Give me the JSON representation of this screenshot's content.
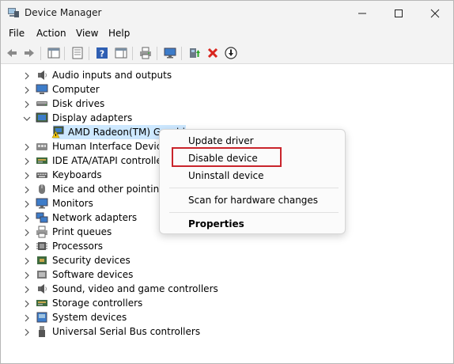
{
  "window": {
    "title": "Device Manager",
    "minimize_icon": "minimize-icon",
    "maximize_icon": "maximize-icon",
    "close_icon": "close-icon"
  },
  "menu": {
    "items": [
      "File",
      "Action",
      "View",
      "Help"
    ]
  },
  "toolbar": {
    "icons": [
      "back-arrow-icon",
      "forward-arrow-icon",
      "show-hide-tree-icon",
      "properties-sheet-icon",
      "help-icon",
      "action-pane-icon",
      "printer-icon",
      "monitor-icon",
      "update-driver-icon",
      "uninstall-x-icon",
      "download-arrow-icon"
    ]
  },
  "tree": {
    "items": [
      {
        "label": "Audio inputs and outputs",
        "icon": "speaker-icon",
        "expanded": false
      },
      {
        "label": "Computer",
        "icon": "computer-icon",
        "expanded": false
      },
      {
        "label": "Disk drives",
        "icon": "disk-drive-icon",
        "expanded": false
      },
      {
        "label": "Display adapters",
        "icon": "display-adapter-icon",
        "expanded": true
      },
      {
        "label": "AMD Radeon(TM) Graphics",
        "icon": "warning-display-icon",
        "child": true,
        "selected": true
      },
      {
        "label": "Human Interface Devices",
        "icon": "hid-icon",
        "expanded": false
      },
      {
        "label": "IDE ATA/ATAPI controllers",
        "icon": "ide-controller-icon",
        "expanded": false
      },
      {
        "label": "Keyboards",
        "icon": "keyboard-icon",
        "expanded": false
      },
      {
        "label": "Mice and other pointing devices",
        "icon": "mouse-icon",
        "expanded": false
      },
      {
        "label": "Monitors",
        "icon": "monitor-icon",
        "expanded": false
      },
      {
        "label": "Network adapters",
        "icon": "network-adapter-icon",
        "expanded": false
      },
      {
        "label": "Print queues",
        "icon": "printer-icon",
        "expanded": false
      },
      {
        "label": "Processors",
        "icon": "processor-icon",
        "expanded": false
      },
      {
        "label": "Security devices",
        "icon": "security-device-icon",
        "expanded": false
      },
      {
        "label": "Software devices",
        "icon": "software-device-icon",
        "expanded": false
      },
      {
        "label": "Sound, video and game controllers",
        "icon": "sound-icon",
        "expanded": false
      },
      {
        "label": "Storage controllers",
        "icon": "storage-controller-icon",
        "expanded": false
      },
      {
        "label": "System devices",
        "icon": "system-device-icon",
        "expanded": false
      },
      {
        "label": "Universal Serial Bus controllers",
        "icon": "usb-icon",
        "expanded": false
      }
    ]
  },
  "context_menu": {
    "update_driver": "Update driver",
    "disable_device": "Disable device",
    "uninstall_device": "Uninstall device",
    "scan_hardware": "Scan for hardware changes",
    "properties": "Properties"
  },
  "colors": {
    "selection": "#cde8ff",
    "highlight_border": "#c9242b",
    "warning": "#f2c811",
    "toolbar_red_x": "#d9251d"
  }
}
